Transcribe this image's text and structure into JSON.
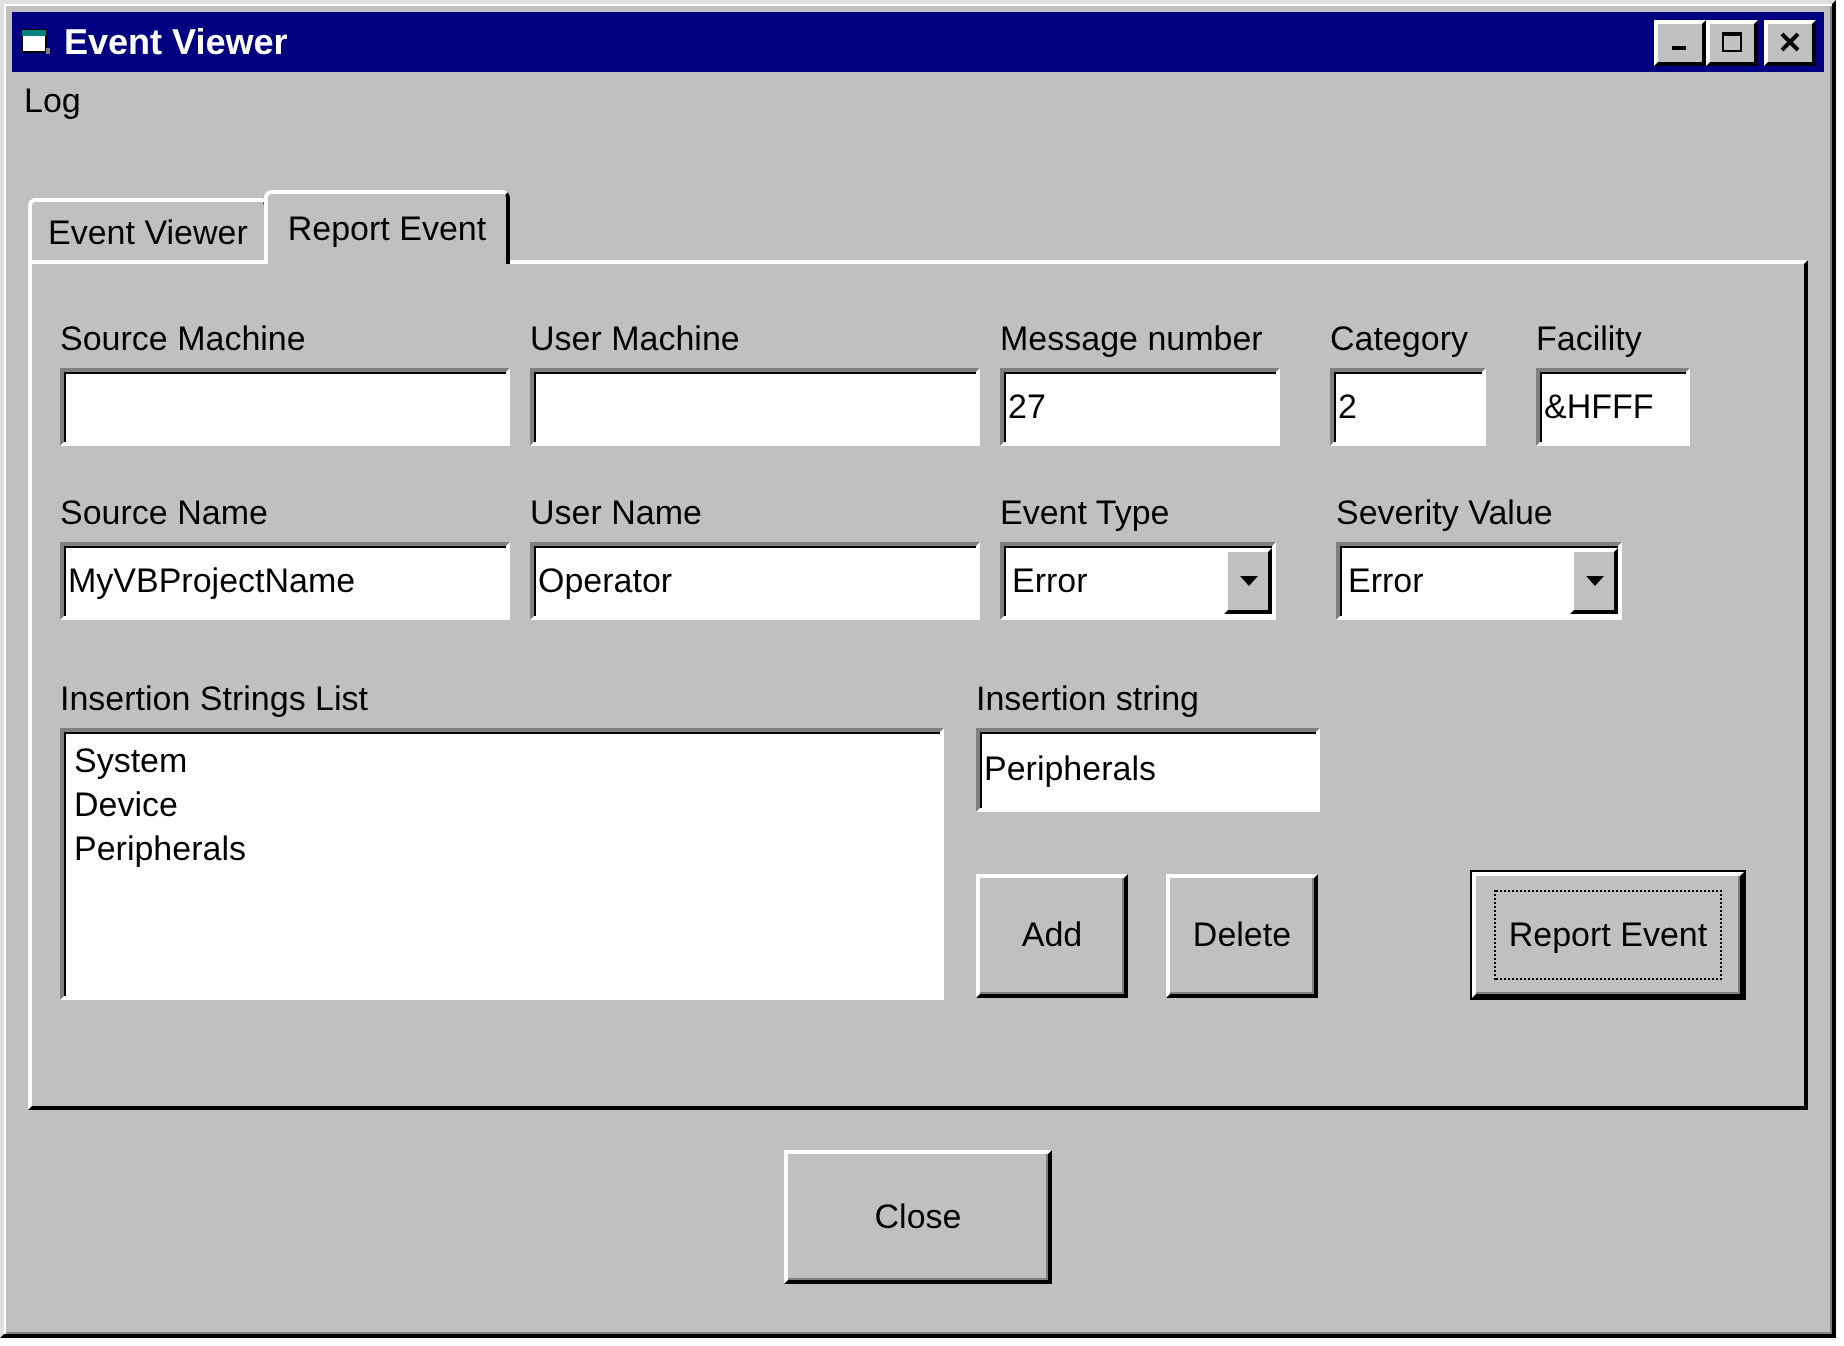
{
  "window": {
    "title": "Event Viewer"
  },
  "menu": [
    "Log"
  ],
  "tabs": [
    {
      "label": "Event Viewer",
      "selected": false
    },
    {
      "label": "Report Event",
      "selected": true
    }
  ],
  "row1": [
    {
      "label": "Source Machine"
    },
    {
      "label": "User Machine"
    },
    {
      "label": "Message number",
      "value": "27"
    },
    {
      "label": "Category",
      "value": "2"
    },
    {
      "label": "Facility",
      "value": "&HFFF"
    }
  ],
  "row2": [
    {
      "label": "Source Name",
      "kind": "text",
      "value": "MyVBProjectName"
    },
    {
      "label": "User Name",
      "kind": "text",
      "value": "Operator"
    },
    {
      "label": "Event Type",
      "kind": "combo",
      "value": "Error"
    },
    {
      "label": "Severity Value",
      "kind": "combo",
      "value": "Error"
    }
  ],
  "insertion_list": {
    "label": "Insertion Strings List",
    "items": [
      "System",
      "Device",
      "Peripherals"
    ]
  },
  "insertion_string": {
    "label": "Insertion string",
    "value": "Peripherals"
  },
  "buttons": [
    {
      "label": "Add",
      "default": false
    },
    {
      "label": "Delete",
      "default": false
    },
    {
      "label": "Report Event",
      "default": true
    }
  ],
  "close_button": "Close"
}
